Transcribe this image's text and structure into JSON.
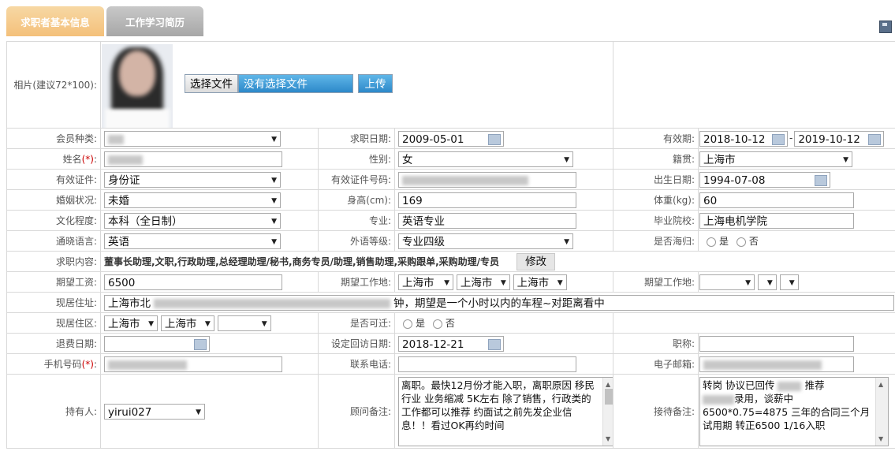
{
  "tabs": [
    "求职者基本信息",
    "工作学习简历"
  ],
  "photo": {
    "label": "相片(建议72*100):",
    "choose_label": "选择文件",
    "file_status": "没有选择文件",
    "upload_label": "上传"
  },
  "labels": {
    "member_type": "会员种类:",
    "job_date": "求职日期:",
    "validity": "有效期:",
    "name": "姓名",
    "name_req": "(*)",
    "gender": "性别:",
    "native_place": "籍贯:",
    "id_type": "有效证件:",
    "id_no": "有效证件号码:",
    "birth": "出生日期:",
    "marital": "婚姻状况:",
    "height": "身高(cm):",
    "weight": "体重(kg):",
    "education": "文化程度:",
    "major": "专业:",
    "school": "毕业院校:",
    "language": "通晓语言:",
    "lang_level": "外语等级:",
    "overseas": "是否海归:",
    "job_content": "求职内容:",
    "salary": "期望工资:",
    "work_place": "期望工作地:",
    "work_place2": "期望工作地:",
    "address": "现居住址:",
    "district": "现居住区:",
    "relocate": "是否可迁:",
    "refund_date": "退费日期:",
    "visit_date": "设定回访日期:",
    "title": "职称:",
    "mobile": "手机号码",
    "mobile_req": "(*)",
    "phone": "联系电话:",
    "email": "电子邮箱:",
    "holder": "持有人:",
    "advisor_note": "顾问备注:",
    "reception_note": "接待备注:"
  },
  "values": {
    "job_date": "2009-05-01",
    "valid_from": "2018-10-12",
    "valid_sep": "-",
    "valid_to": "2019-10-12",
    "gender": "女",
    "native_place": "上海市",
    "id_type": "身份证",
    "birth": "1994-07-08",
    "marital": "未婚",
    "height": "169",
    "weight": "60",
    "education": "本科（全日制）",
    "major": "英语专业",
    "school": "上海电机学院",
    "language": "英语",
    "lang_level": "专业四级",
    "yes": "是",
    "no": "否",
    "job_content": "董事长助理,文职,行政助理,总经理助理/秘书,商务专员/助理,销售助理,采购跟单,采购助理/专员",
    "modify_label": "修改",
    "salary": "6500",
    "work_place": [
      "上海市",
      "上海市",
      "上海市"
    ],
    "address_prefix": "上海市北",
    "address_suffix": "钟，期望是一个小时以内的车程~对距离看中",
    "district": [
      "上海市",
      "上海市"
    ],
    "visit_date": "2018-12-21",
    "holder": "yirui027",
    "advisor_note": "离职。最快12月份才能入职，离职原因 移民行业 业务缩减  5K左右 除了销售，行政类的工作都可以推荐 约面试之前先发企业信息！！看过OK再约时间",
    "reception_note_1": "转岗 协议已回传",
    "reception_note_2": "推荐",
    "reception_note_3": "录用，谈薪中",
    "reception_note_4": "6500*0.75=4875 三年的合同三个月试用期 转正6500 1/16入职"
  },
  "icons": [
    "save-icon",
    "calendar-icon",
    "dropdown-arrow-icon",
    "scrollbar"
  ]
}
